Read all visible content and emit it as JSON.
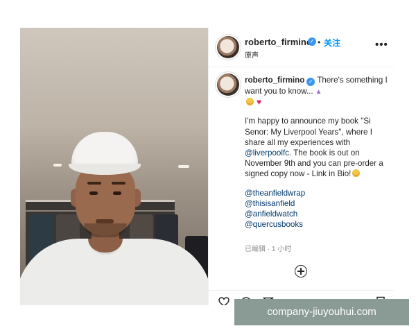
{
  "post": {
    "author": {
      "username": "roberto_firmino",
      "verified": true,
      "follow_label": "关注",
      "separator": "•",
      "audio_label": "原声"
    },
    "more_label": "•••",
    "caption": {
      "author": "roberto_firmino",
      "line1": "There's something I want you to know...",
      "paragraph": "I'm happy to announce my book \"Si Senor: My Liverpool Years\", where I share all my experiences with ",
      "mention": "@liverpoolfc",
      "paragraph_end": ". The book is out on November 9th and you can pre-order a signed copy now - Link in Bio!",
      "tags": [
        "@theanfieldwrap",
        "@thisisanfield",
        "@anfieldwatch",
        "@quercusbooks"
      ]
    },
    "meta": "已编辑 · 1 小时",
    "icons": {
      "verified": "verified-badge-icon",
      "more": "more-options-icon",
      "add_comment": "add-comment-icon",
      "like": "heart-icon",
      "comment": "comment-icon",
      "share": "share-icon",
      "save": "bookmark-icon"
    }
  },
  "watermark": "company-jiuyouhui.com",
  "colors": {
    "link": "#00376b",
    "follow": "#0095f6",
    "verified": "#3897f0",
    "watermark_bg": "#8a9a95"
  }
}
